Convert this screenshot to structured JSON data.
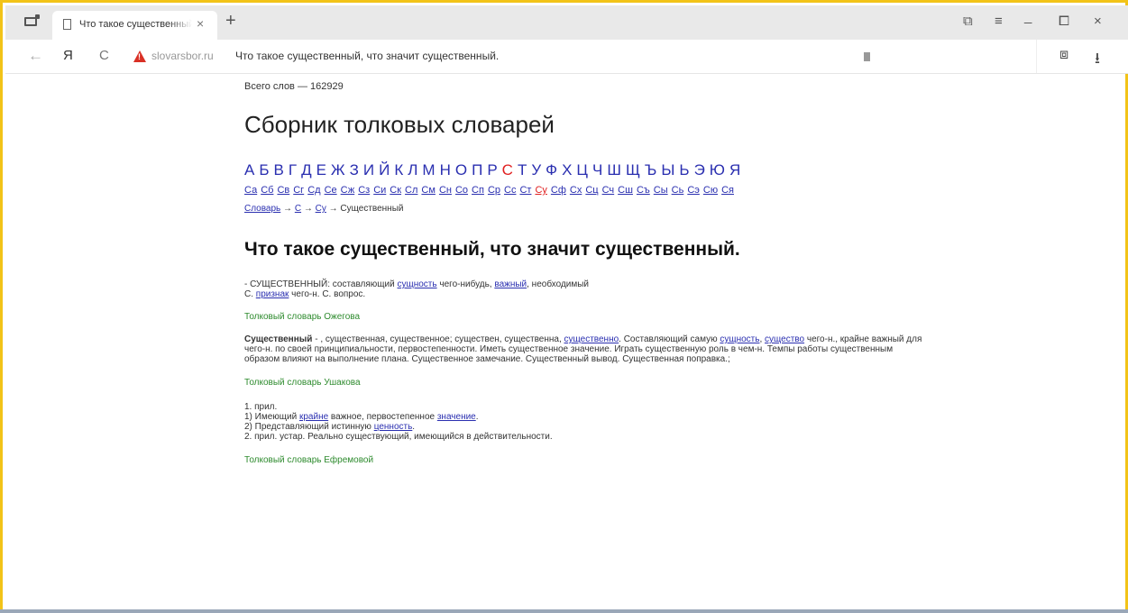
{
  "browser": {
    "tab_title": "Что такое существенный, что значит существенный.",
    "tab_close": "×",
    "new_tab": "+",
    "win_controls": [
      "⧉",
      "≡",
      "_",
      "⧠",
      "×"
    ],
    "back": "←",
    "yandex_logo": "Я",
    "reload": "C",
    "domain": "slovarsbor.ru",
    "address_title": "Что такое существенный, что значит существенный.",
    "extension": "⧈",
    "download": "⭳"
  },
  "page": {
    "word_count": "Всего слов — 162929",
    "title": "Сборник толковых словарей",
    "alphabet": [
      "А",
      "Б",
      "В",
      "Г",
      "Д",
      "Е",
      "Ж",
      "З",
      "И",
      "Й",
      "К",
      "Л",
      "М",
      "Н",
      "О",
      "П",
      "Р",
      "С",
      "Т",
      "У",
      "Ф",
      "Х",
      "Ц",
      "Ч",
      "Ш",
      "Щ",
      "Ъ",
      "Ы",
      "Ь",
      "Э",
      "Ю",
      "Я"
    ],
    "alphabet_active": "С",
    "subletters": [
      "Са",
      "Сб",
      "Св",
      "Сг",
      "Сд",
      "Се",
      "Сж",
      "Сз",
      "Си",
      "Ск",
      "Сл",
      "См",
      "Сн",
      "Со",
      "Сп",
      "Ср",
      "Сс",
      "Ст",
      "Су",
      "Сф",
      "Сх",
      "Сц",
      "Сч",
      "Сш",
      "Съ",
      "Сы",
      "Сь",
      "Сэ",
      "Сю",
      "Ся"
    ],
    "subletter_active": "Су",
    "breadcrumb": {
      "dict": "Словарь",
      "arrow": " → ",
      "letter": "С",
      "sub": "Су",
      "current": "Существенный"
    },
    "heading": "Что такое существенный, что значит существенный.",
    "entry1": {
      "a": "- СУЩЕСТВЕННЫЙ: составляющий ",
      "link1": "сущность",
      "b": " чего-нибудь, ",
      "link2": "важный",
      "c": ", необходимый",
      "d": "С. ",
      "link3": "признак",
      "e": " чего-н. С. вопрос."
    },
    "source1": "Толковый словарь Ожегова",
    "entry2": {
      "bold": "Существенный",
      "a": " - , существенная, существенное; существен, существенна, ",
      "link1": "существенно",
      "b": ". Составляющий самую ",
      "link2": "сущность",
      "c": ", ",
      "link3": "существо",
      "d": " чего-н., крайне важный для чего-н. по своей принципиальности, первостепенности. Иметь существенное значение. Играть существенную роль в чем-н. Темпы работы существенным образом влияют на выполнение плана. Существенное замечание. Существенный вывод. Существенная поправка.;"
    },
    "source2": "Толковый словарь Ушакова",
    "entry3": {
      "l1": "1. прил.",
      "l2a": "1) Имеющий ",
      "l2link": "крайне",
      "l2b": " важное, первостепенное ",
      "l2link2": "значение",
      "l2c": ".",
      "l3a": "2) Представляющий истинную ",
      "l3link": "ценность",
      "l3b": ".",
      "l4": "2. прил. устар. Реально существующий, имеющийся в действительности."
    },
    "source3": "Толковый словарь Ефремовой"
  }
}
